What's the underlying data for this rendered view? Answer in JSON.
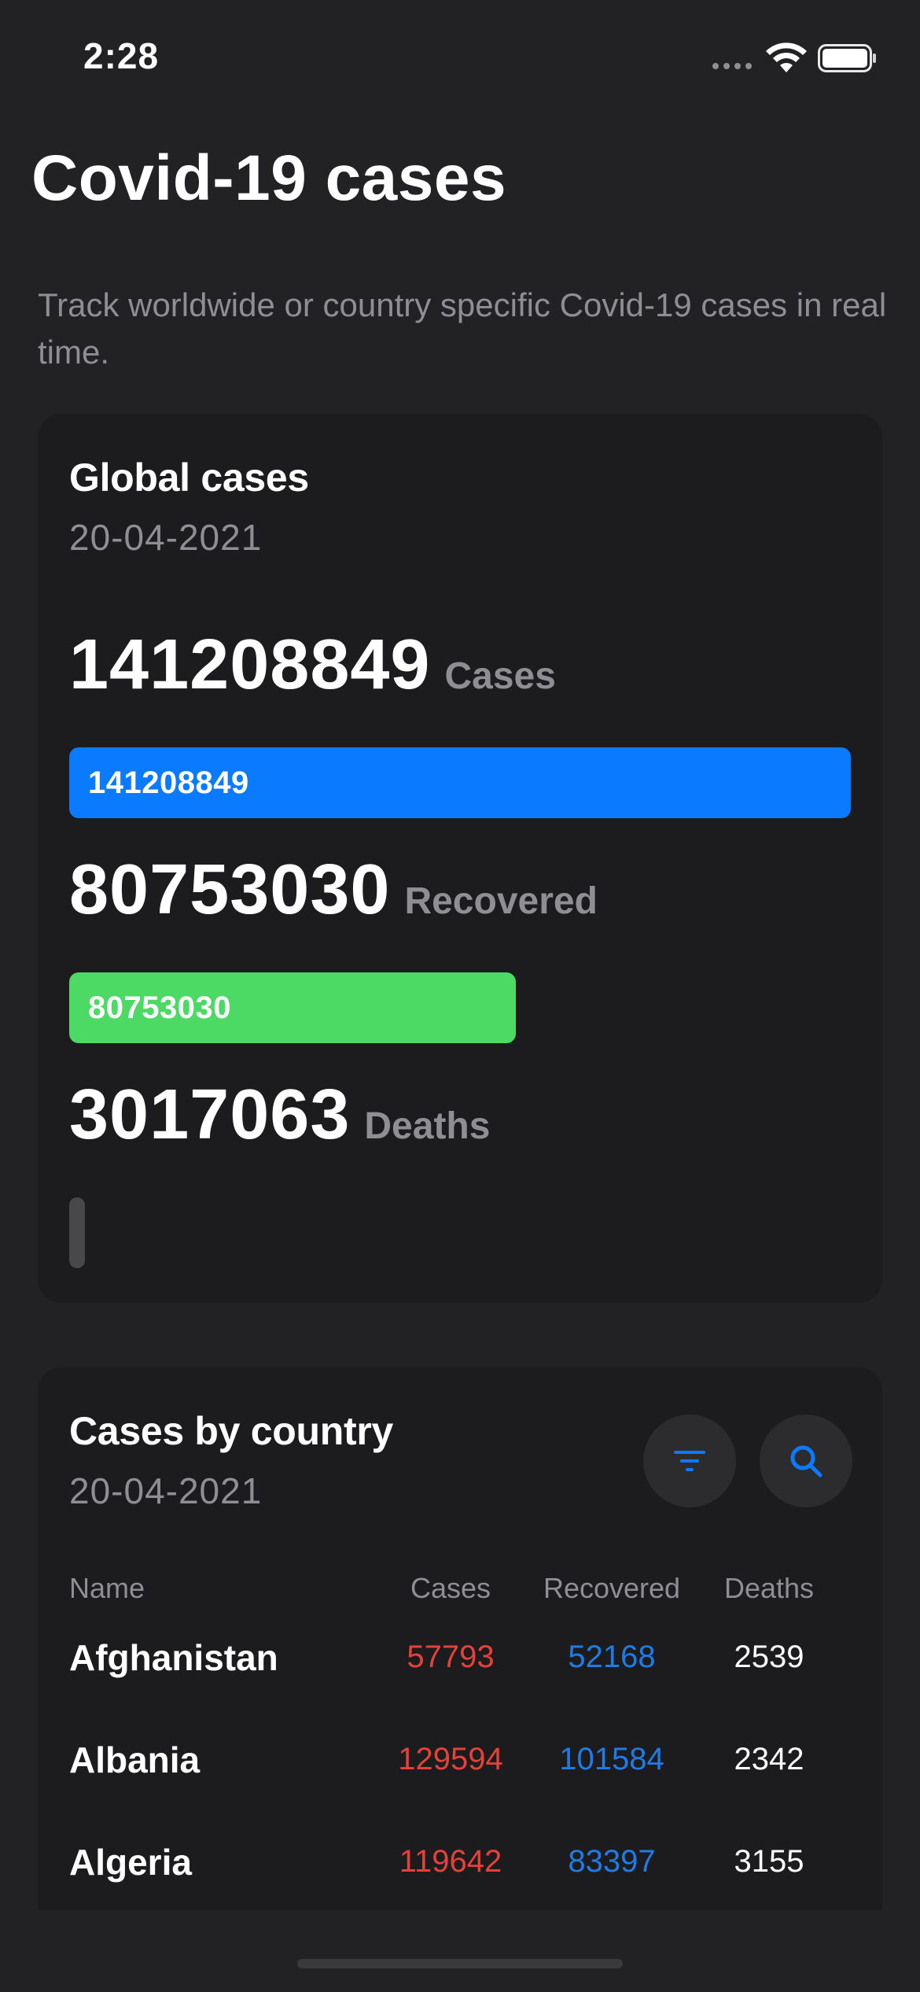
{
  "status_bar": {
    "time": "2:28"
  },
  "header": {
    "title": "Covid-19 cases",
    "subtitle": "Track worldwide or country specific Covid-19 cases in real time."
  },
  "global_card": {
    "title": "Global cases",
    "date": "20-04-2021",
    "cases": {
      "value": "141208849",
      "label": "Cases",
      "bar_text": "141208849",
      "bar_fraction": 1.0
    },
    "recovered": {
      "value": "80753030",
      "label": "Recovered",
      "bar_text": "80753030",
      "bar_fraction": 0.572
    },
    "deaths": {
      "value": "3017063",
      "label": "Deaths",
      "bar_fraction": 0.021
    }
  },
  "country_card": {
    "title": "Cases by country",
    "date": "20-04-2021",
    "columns": {
      "name": "Name",
      "cases": "Cases",
      "recovered": "Recovered",
      "deaths": "Deaths"
    },
    "rows": [
      {
        "name": "Afghanistan",
        "cases": "57793",
        "recovered": "52168",
        "deaths": "2539"
      },
      {
        "name": "Albania",
        "cases": "129594",
        "recovered": "101584",
        "deaths": "2342"
      },
      {
        "name": "Algeria",
        "cases": "119642",
        "recovered": "83397",
        "deaths": "3155"
      }
    ]
  },
  "colors": {
    "background": "#222224",
    "card": "#1c1c1e",
    "accent_blue": "#0a7aff",
    "accent_green": "#4cd964",
    "cases_red": "#e5413a",
    "recovered_blue": "#1f7be6",
    "secondary_text": "#8e8e93"
  },
  "icons": [
    "wifi-icon",
    "battery-icon",
    "filter-icon",
    "search-icon"
  ]
}
